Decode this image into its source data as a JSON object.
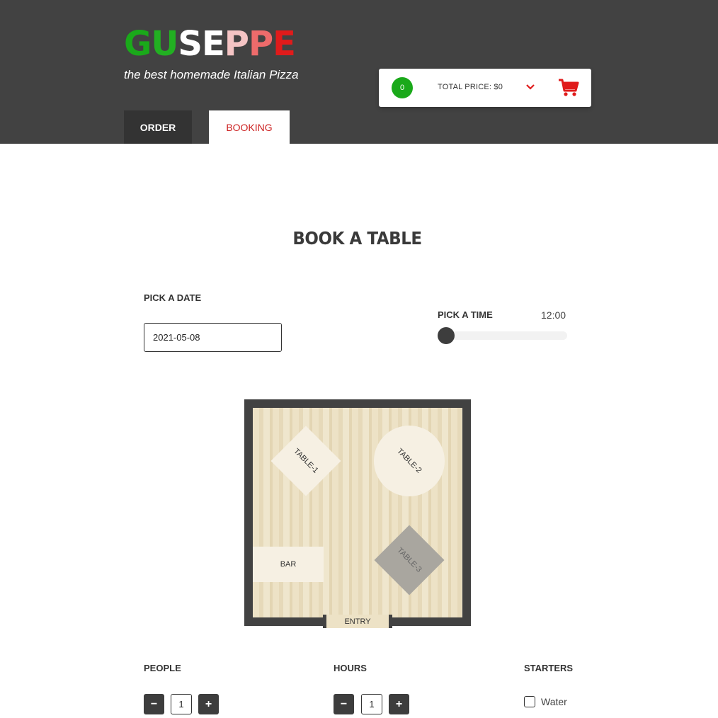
{
  "header": {
    "logo_letters": [
      {
        "char": "G",
        "color": "#1aa91a"
      },
      {
        "char": "U",
        "color": "#22b022"
      },
      {
        "char": "S",
        "color": "#ffffff"
      },
      {
        "char": "E",
        "color": "#ffffff"
      },
      {
        "char": "P",
        "color": "#f4c4c4"
      },
      {
        "char": "P",
        "color": "#ee6b6b"
      },
      {
        "char": "E",
        "color": "#e01b1b"
      }
    ],
    "tagline": "the best homemade Italian Pizza",
    "tabs": {
      "order": "ORDER",
      "booking": "BOOKING"
    }
  },
  "cart": {
    "count": "0",
    "total_label": "TOTAL PRICE: $0",
    "chevron_icon": "chevron-down-icon",
    "cart_icon": "shopping-cart-icon",
    "accent_color": "#e01b1b",
    "count_color": "#1aa91a"
  },
  "booking": {
    "title": "BOOK A TABLE",
    "date_label": "PICK A DATE",
    "date_value": "2021-05-08",
    "time_label": "PICK A TIME",
    "time_value": "12:00",
    "time_slider_fraction": 0
  },
  "floor_plan": {
    "table1": "TABLE-1",
    "table2": "TABLE-2",
    "table3": "TABLE-3",
    "bar": "BAR",
    "entry": "ENTRY"
  },
  "controls": {
    "people_label": "PEOPLE",
    "people_value": "1",
    "hours_label": "HOURS",
    "hours_value": "1",
    "starters_label": "STARTERS",
    "starter_water": "Water",
    "minus": "−",
    "plus": "+"
  }
}
